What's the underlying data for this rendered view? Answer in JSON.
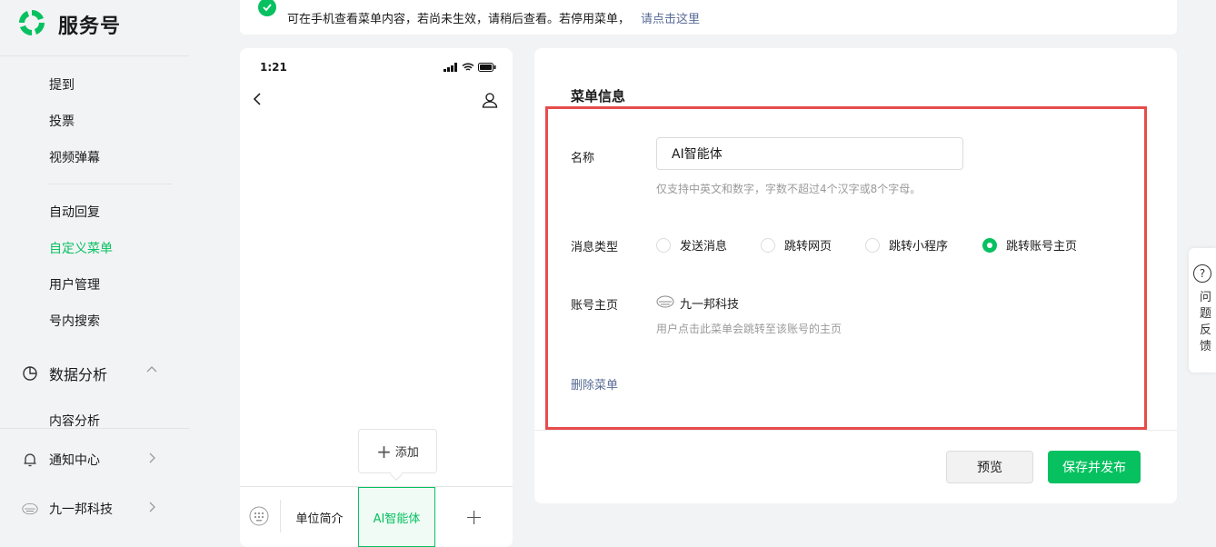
{
  "app": {
    "brand_name": "服务号"
  },
  "sidebar": {
    "items": [
      {
        "label": "提到"
      },
      {
        "label": "投票"
      },
      {
        "label": "视频弹幕"
      },
      {
        "label": "自动回复"
      },
      {
        "label": "自定义菜单",
        "active": true
      },
      {
        "label": "用户管理"
      },
      {
        "label": "号内搜索"
      }
    ],
    "data_group": {
      "label": "数据分析",
      "icon": "pie-chart-icon",
      "expanded": true
    },
    "data_items": [
      {
        "label": "内容分析"
      }
    ],
    "notify": {
      "label": "通知中心",
      "icon": "bell-icon"
    },
    "account": {
      "label": "九一邦科技",
      "icon": "account-avatar-icon"
    }
  },
  "notice": {
    "text": "可在手机查看菜单内容，若尚未生效，请稍后查看。若停用菜单，",
    "link": "请点击这里"
  },
  "phone": {
    "time": "1:21",
    "add_popup_label": "添加",
    "menus": [
      "单位简介",
      "AI智能体"
    ],
    "add_menu_symbol": "+"
  },
  "editor": {
    "title": "菜单信息",
    "name_label": "名称",
    "name_value": "AI智能体",
    "name_hint": "仅支持中英文和数字，字数不超过4个汉字或8个字母。",
    "type_label": "消息类型",
    "types": [
      {
        "label": "发送消息",
        "checked": false
      },
      {
        "label": "跳转网页",
        "checked": false
      },
      {
        "label": "跳转小程序",
        "checked": false
      },
      {
        "label": "跳转账号主页",
        "checked": true
      }
    ],
    "homepage_label": "账号主页",
    "account_name": "九一邦科技",
    "homepage_hint": "用户点击此菜单会跳转至该账号的主页",
    "delete_label": "删除菜单",
    "preview_button": "预览",
    "publish_button": "保存并发布"
  },
  "feedback": {
    "label": "问题反馈",
    "icon": "question-icon"
  },
  "colors": {
    "accent": "#07c160",
    "link": "#576b95",
    "highlight_border": "#e74c4c"
  }
}
